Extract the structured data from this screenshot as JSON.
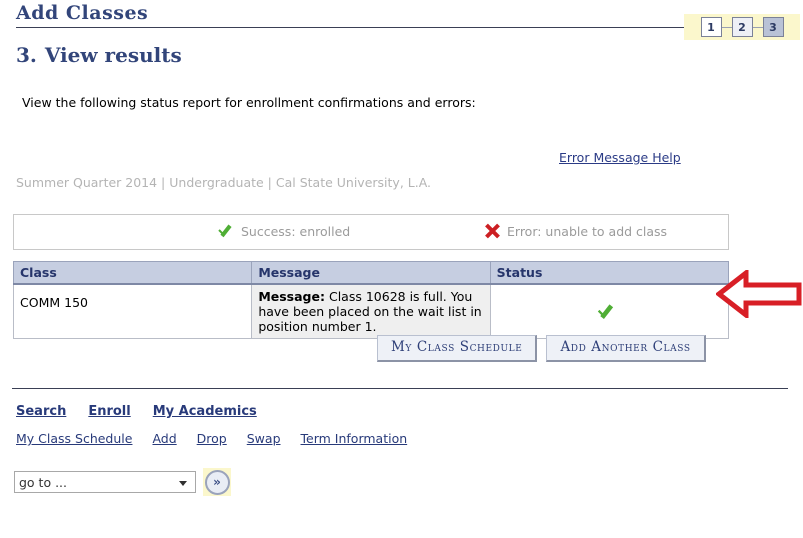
{
  "header": {
    "title": "Add Classes",
    "steps": [
      {
        "label": "1",
        "state": "done"
      },
      {
        "label": "2",
        "state": "done"
      },
      {
        "label": "3",
        "state": "current"
      }
    ]
  },
  "section": {
    "number": "3.",
    "heading": "View results",
    "intro": "View the following status report for enrollment confirmations and errors:"
  },
  "links": {
    "error_message_help": "Error Message Help"
  },
  "context_line": "Summer Quarter 2014 | Undergraduate | Cal State University, L.A.",
  "legend": {
    "success": {
      "icon": "check-icon",
      "label": "Success: enrolled",
      "color": "#4fae35"
    },
    "error": {
      "icon": "x-icon",
      "label": "Error: unable to add class",
      "color": "#cc1f23"
    }
  },
  "results": {
    "columns": [
      "Class",
      "Message",
      "Status"
    ],
    "rows": [
      {
        "class": "COMM  150",
        "message_label": "Message:",
        "message_text": " Class 10628 is full. You have been placed on the wait list in position number 1.",
        "status_icon": "check-icon"
      }
    ]
  },
  "annotation": {
    "icon": "left-arrow-annotation",
    "color": "#d81f26"
  },
  "buttons": {
    "my_class_schedule": "My Class Schedule",
    "add_another_class": "Add Another Class"
  },
  "footer": {
    "primary_nav": [
      "Search",
      "Enroll",
      "My Academics"
    ],
    "secondary_nav": [
      "My Class Schedule",
      "Add",
      "Drop",
      "Swap",
      "Term Information"
    ],
    "goto": {
      "value": "go to ...",
      "button_icon": "double-chevron-right-icon",
      "button_glyph": "»"
    }
  }
}
